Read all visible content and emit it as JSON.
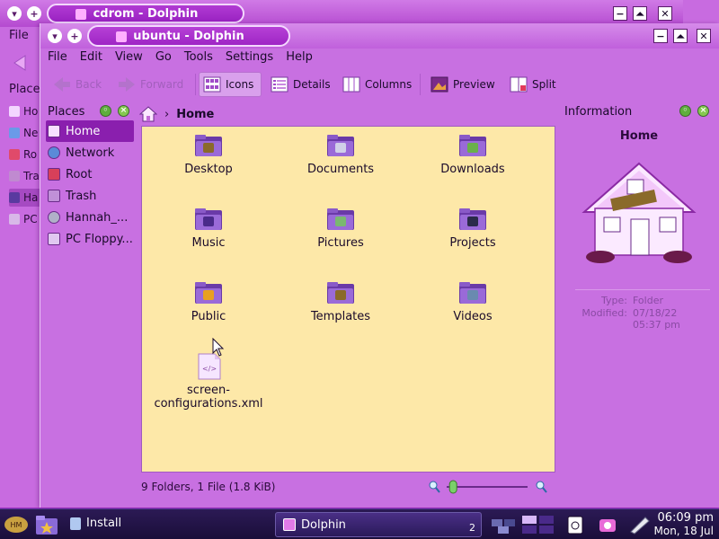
{
  "bg_window": {
    "title": "cdrom - Dolphin",
    "menu_first": "File",
    "places_label": "Places",
    "sidebar_items": [
      "Ho",
      "Ne",
      "Ro",
      "Tra",
      "Ha",
      "PC"
    ]
  },
  "window": {
    "title": "ubuntu - Dolphin"
  },
  "menu": [
    "File",
    "Edit",
    "View",
    "Go",
    "Tools",
    "Settings",
    "Help"
  ],
  "toolbar": {
    "back": "Back",
    "forward": "Forward",
    "icons": "Icons",
    "details": "Details",
    "columns": "Columns",
    "preview": "Preview",
    "split": "Split"
  },
  "places": {
    "title": "Places",
    "items": [
      {
        "label": "Home",
        "selected": true,
        "icon": "home-icon"
      },
      {
        "label": "Network",
        "selected": false,
        "icon": "network-icon"
      },
      {
        "label": "Root",
        "selected": false,
        "icon": "root-icon"
      },
      {
        "label": "Trash",
        "selected": false,
        "icon": "trash-icon"
      },
      {
        "label": "Hannah_...",
        "selected": false,
        "icon": "cdrom-icon"
      },
      {
        "label": "PC Floppy...",
        "selected": false,
        "icon": "floppy-icon"
      }
    ]
  },
  "breadcrumb": {
    "current": "Home"
  },
  "files": [
    {
      "name": "Desktop",
      "icon": "desktop-folder-icon"
    },
    {
      "name": "Documents",
      "icon": "documents-folder-icon"
    },
    {
      "name": "Downloads",
      "icon": "downloads-folder-icon"
    },
    {
      "name": "Music",
      "icon": "music-folder-icon"
    },
    {
      "name": "Pictures",
      "icon": "pictures-folder-icon"
    },
    {
      "name": "Projects",
      "icon": "projects-folder-icon"
    },
    {
      "name": "Public",
      "icon": "public-folder-icon"
    },
    {
      "name": "Templates",
      "icon": "templates-folder-icon"
    },
    {
      "name": "Videos",
      "icon": "videos-folder-icon"
    },
    {
      "name": "screen-\nconfigurations.xml",
      "icon": "xml-file-icon"
    }
  ],
  "info": {
    "panel_title": "Information",
    "name": "Home",
    "type_label": "Type:",
    "type_value": "Folder",
    "modified_label": "Modified:",
    "modified_value": "07/18/22",
    "modified_time": "05:37 pm"
  },
  "status": {
    "text": "9 Folders, 1 File (1.8 KiB)",
    "zoom_level": 0.08
  },
  "taskbar": {
    "install_label": "Install",
    "dolphin_label": "Dolphin",
    "dolphin_count": "2",
    "time": "06:09 pm",
    "date": "Mon, 18 Jul"
  },
  "colors": {
    "accent": "#8a1fae",
    "view_bg": "#fde8a8",
    "window_bg": "#c870e1",
    "taskbar_bg": "#1a0e3a"
  }
}
